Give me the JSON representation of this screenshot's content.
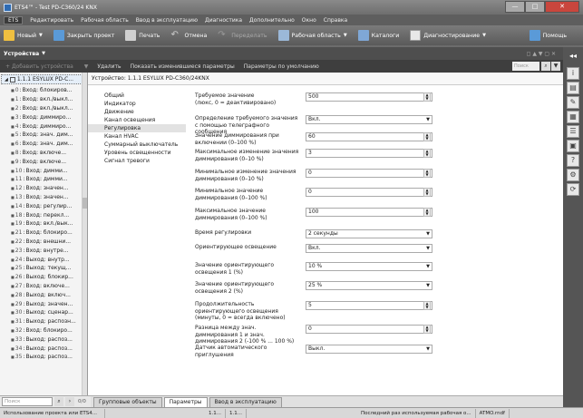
{
  "window": {
    "title": "ETS4™ - Test PD-C360/24 KNX",
    "controls": [
      "—",
      "□",
      "✕"
    ]
  },
  "menu": [
    "ETS",
    "Редактировать",
    "Рабочая область",
    "Ввод в эксплуатацию",
    "Диагностика",
    "Дополнительно",
    "Окно",
    "Справка"
  ],
  "toolbar": {
    "new": "Новый",
    "close_project": "Закрыть проект",
    "print": "Печать",
    "undo": "Отмена",
    "redo": "Переделать",
    "workspace": "Рабочая область",
    "catalogs": "Каталоги",
    "diagnostics": "Диагностирование",
    "help": "Помощь"
  },
  "panel": {
    "title": "Устройства",
    "actions": {
      "add": "Добавить устройства",
      "delete": "Удалить",
      "show_changed": "Показать изменившиеся параметры",
      "defaults": "Параметры по умолчанию"
    },
    "search_placeholder": "Поиск"
  },
  "tree": {
    "root": "1.1.1 ESYLUX PD-C...",
    "items": [
      {
        "num": "0",
        "label": "Вход: блокиров..."
      },
      {
        "num": "1",
        "label": "Вход: вкл./выкл..."
      },
      {
        "num": "2",
        "label": "Вход: вкл./выкл..."
      },
      {
        "num": "3",
        "label": "Вход: диммиро..."
      },
      {
        "num": "4",
        "label": "Вход: диммиро..."
      },
      {
        "num": "5",
        "label": "Вход: знач. дим..."
      },
      {
        "num": "6",
        "label": "Вход: знач. дим..."
      },
      {
        "num": "8",
        "label": "Вход: включе..."
      },
      {
        "num": "9",
        "label": "Вход: включе..."
      },
      {
        "num": "10",
        "label": "Вход: димми..."
      },
      {
        "num": "11",
        "label": "Вход: димми..."
      },
      {
        "num": "12",
        "label": "Вход: значен..."
      },
      {
        "num": "13",
        "label": "Вход: значен..."
      },
      {
        "num": "14",
        "label": "Вход: регулир..."
      },
      {
        "num": "18",
        "label": "Вход: перекл..."
      },
      {
        "num": "19",
        "label": "Вход: вкл./вык..."
      },
      {
        "num": "21",
        "label": "Вход: блокиро..."
      },
      {
        "num": "22",
        "label": "Вход: внешни..."
      },
      {
        "num": "23",
        "label": "Вход: внутре..."
      },
      {
        "num": "24",
        "label": "Выход: внутр..."
      },
      {
        "num": "25",
        "label": "Выход: текущ..."
      },
      {
        "num": "26",
        "label": "Выход: блокир..."
      },
      {
        "num": "27",
        "label": "Вход: включе..."
      },
      {
        "num": "28",
        "label": "Выход: включ..."
      },
      {
        "num": "29",
        "label": "Выход: значен..."
      },
      {
        "num": "30",
        "label": "Выход: сценар..."
      },
      {
        "num": "31",
        "label": "Выход: распозн..."
      },
      {
        "num": "32",
        "label": "Вход: блокиро..."
      },
      {
        "num": "33",
        "label": "Выход: распоз..."
      },
      {
        "num": "34",
        "label": "Выход: распоз..."
      },
      {
        "num": "35",
        "label": "Выход: распоз..."
      }
    ],
    "search_placeholder": "Поиск",
    "count": "0/0"
  },
  "breadcrumb": "Устройство: 1.1.1  ESYLUX PD-C360/24KNX",
  "categories": [
    "Общий",
    "Индикатор",
    "Движение",
    "Канал освещения",
    "Регулировка",
    "Канал HVAC",
    "Суммарный выключатель",
    "Уровень освещенности",
    "Сигнал тревоги"
  ],
  "active_category": 4,
  "params": [
    {
      "label": "Требуемое значение\n  (люкс, 0 = деактивировано)",
      "value": "500",
      "kind": "num"
    },
    {
      "label": "Определение требуемого значения с помощью телеграфного сообщения",
      "value": "Вкл.",
      "kind": "select"
    },
    {
      "label": "Значение диммирования при включении (0–100 %)",
      "value": "60",
      "kind": "num"
    },
    {
      "label": "Максимальное изменение значения диммирования (0–10 %)",
      "value": "3",
      "kind": "num"
    },
    {
      "label": "Минимальное изменение значения диммирования (0–10 %)",
      "value": "0",
      "kind": "num"
    },
    {
      "label": "Минимальное значение диммирования (0–100 %)",
      "value": "0",
      "kind": "num"
    },
    {
      "label": "Максимальное значение диммирования (0–100 %)",
      "value": "100",
      "kind": "num"
    },
    {
      "label": "Время регулировки",
      "value": "2 секунды",
      "kind": "select"
    },
    {
      "label": "Ориентирующее освещение",
      "value": "Вкл.",
      "kind": "select"
    },
    {
      "label": "Значение ориентирующего освещения 1 (%)",
      "value": "10  %",
      "kind": "select"
    },
    {
      "label": "Значение ориентирующего освещения 2 (%)",
      "value": "25  %",
      "kind": "select"
    },
    {
      "label": "Продолжительность ориентирующего освещения\n  (минуты, 0 = всегда включено)",
      "value": "5",
      "kind": "num"
    },
    {
      "label": "Разница между знач. диммирования 1 и знач. диммирования 2 (-100 % ... 100 %)",
      "value": "0",
      "kind": "num"
    },
    {
      "label": "Датчик автоматического приглушения",
      "value": "Выкл.",
      "kind": "select"
    }
  ],
  "tabs": [
    "Групповые объекты",
    "Параметры",
    "Ввод в эксплуатацию"
  ],
  "active_tab": 1,
  "status": {
    "left": "Использование проекта или ETS4...",
    "address": "1.1...",
    "address2": "1.1...",
    "last_used": "Последний раз используемая рабочая о...",
    "file": "ATMO.rndf"
  },
  "colors": {
    "chrome": "#6e6e6e",
    "selected": "#e2e2e2"
  }
}
